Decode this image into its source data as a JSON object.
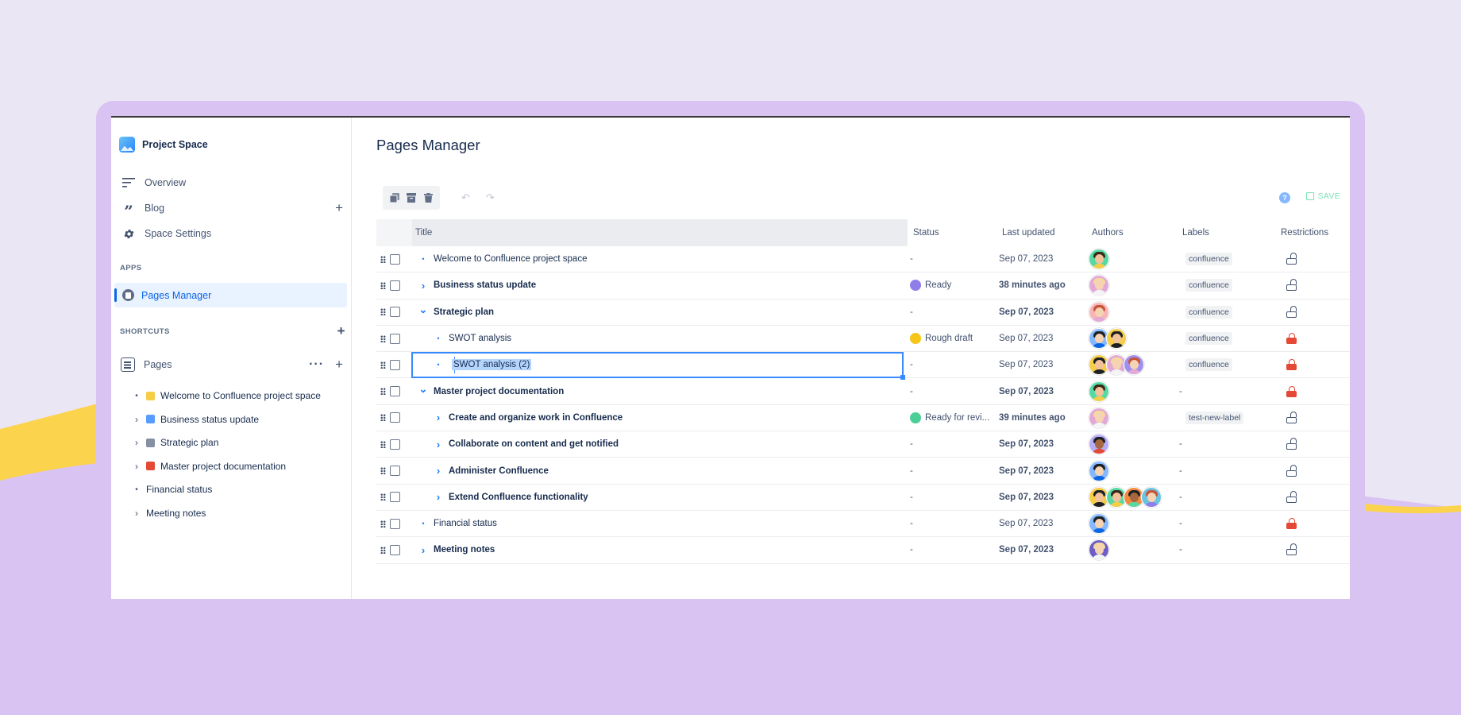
{
  "colors": {
    "background": "#ebe6f3",
    "frame": "#d8c3f3",
    "accent": "#0c66e4",
    "yellow_wave": "#fcd34d",
    "status_ready": "#8f7ee7",
    "status_rough_draft": "#f5c518",
    "status_ready_for_review": "#4bce97",
    "restriction_red": "#e34935"
  },
  "sidebar": {
    "space_name": "Project Space",
    "nav": [
      {
        "label": "Overview",
        "icon": "overview-icon"
      },
      {
        "label": "Blog",
        "icon": "quote-icon"
      },
      {
        "label": "Space Settings",
        "icon": "gear-icon"
      }
    ],
    "apps_label": "APPS",
    "active_app": "Pages Manager",
    "shortcuts_label": "SHORTCUTS",
    "pages_label": "Pages",
    "tree": [
      {
        "label": "Welcome to Confluence project space",
        "kind": "bullet",
        "emoji": "wave-emoji"
      },
      {
        "label": "Business status update",
        "kind": "chevron",
        "emoji": "monitor-emoji"
      },
      {
        "label": "Strategic plan",
        "kind": "chevron",
        "emoji": "chart-emoji"
      },
      {
        "label": "Master project documentation",
        "kind": "chevron",
        "emoji": "bookmark-emoji"
      },
      {
        "label": "Financial status",
        "kind": "bullet"
      },
      {
        "label": "Meeting notes",
        "kind": "chevron"
      }
    ]
  },
  "main": {
    "title": "Pages Manager",
    "save_label": "SAVE",
    "help_label": "?",
    "columns": {
      "title": "Title",
      "status": "Status",
      "updated": "Last updated",
      "authors": "Authors",
      "labels": "Labels",
      "restrictions": "Restrictions"
    },
    "rows": [
      {
        "title": "Welcome to Confluence project space",
        "indent": 0,
        "marker": "bullet",
        "bold": false,
        "status": "-",
        "updated": "Sep 07, 2023",
        "updated_bold": false,
        "authors": [
          "a-green"
        ],
        "label": "confluence",
        "lock": "open"
      },
      {
        "title": "Business status update",
        "indent": 0,
        "marker": "chevron-right",
        "bold": true,
        "status": "Ready",
        "status_color": "#8f7ee7",
        "updated": "38 minutes ago",
        "updated_bold": true,
        "authors": [
          "a-pink-blonde"
        ],
        "label": "confluence",
        "lock": "open"
      },
      {
        "title": "Strategic plan",
        "indent": 0,
        "marker": "chevron-down",
        "bold": true,
        "status": "-",
        "updated": "Sep 07, 2023",
        "updated_bold": true,
        "authors": [
          "a-pink-red"
        ],
        "label": "confluence",
        "lock": "open"
      },
      {
        "title": "SWOT analysis",
        "indent": 1,
        "marker": "bullet",
        "bold": false,
        "status": "Rough draft",
        "status_color": "#f5c518",
        "updated": "Sep 07, 2023",
        "updated_bold": false,
        "authors": [
          "a-blue-dark",
          "a-yellow-dark"
        ],
        "label": "confluence",
        "lock": "red"
      },
      {
        "title": "SWOT analysis (2)",
        "indent": 1,
        "marker": "bullet",
        "bold": false,
        "editing": true,
        "status": "-",
        "updated": "Sep 07, 2023",
        "updated_bold": false,
        "authors": [
          "a-yellow-dark",
          "a-pink-blonde",
          "a-purple-red"
        ],
        "label": "confluence",
        "lock": "red"
      },
      {
        "title": "Master project documentation",
        "indent": 0,
        "marker": "chevron-down",
        "bold": true,
        "status": "-",
        "updated": "Sep 07, 2023",
        "updated_bold": true,
        "authors": [
          "a-green"
        ],
        "label": "-",
        "lock": "red"
      },
      {
        "title": "Create and organize work in Confluence",
        "indent": 1,
        "marker": "chevron-right",
        "bold": true,
        "status": "Ready for revi...",
        "status_color": "#4bce97",
        "updated": "39 minutes ago",
        "updated_bold": true,
        "authors": [
          "a-pink-blonde"
        ],
        "label": "test-new-label",
        "lock": "open"
      },
      {
        "title": "Collaborate on content and get notified",
        "indent": 1,
        "marker": "chevron-right",
        "bold": true,
        "status": "-",
        "updated": "Sep 07, 2023",
        "updated_bold": true,
        "authors": [
          "a-purple-dark"
        ],
        "label": "-",
        "lock": "open"
      },
      {
        "title": "Administer Confluence",
        "indent": 1,
        "marker": "chevron-right",
        "bold": true,
        "status": "-",
        "updated": "Sep 07, 2023",
        "updated_bold": true,
        "authors": [
          "a-blue-dark"
        ],
        "label": "-",
        "lock": "open"
      },
      {
        "title": "Extend Confluence functionality",
        "indent": 1,
        "marker": "chevron-right",
        "bold": true,
        "status": "-",
        "updated": "Sep 07, 2023",
        "updated_bold": true,
        "authors": [
          "a-yellow-dark",
          "a-green",
          "a-orange-dark",
          "a-teal-red"
        ],
        "label": "-",
        "lock": "open"
      },
      {
        "title": "Financial status",
        "indent": 0,
        "marker": "bullet",
        "bold": false,
        "status": "-",
        "updated": "Sep 07, 2023",
        "updated_bold": false,
        "authors": [
          "a-blue-dark"
        ],
        "label": "-",
        "lock": "red"
      },
      {
        "title": "Meeting notes",
        "indent": 0,
        "marker": "chevron-right",
        "bold": true,
        "status": "-",
        "updated": "Sep 07, 2023",
        "updated_bold": true,
        "authors": [
          "a-purple-blonde"
        ],
        "label": "-",
        "lock": "open"
      }
    ]
  },
  "avatar_styles": {
    "a-green": {
      "bg": "#57d9a3",
      "hair": "#3a2a1a",
      "skin": "#f2c29b",
      "shirt": "#f5cd47"
    },
    "a-pink-blonde": {
      "bg": "#e2a9d6",
      "hair": "#f4d9a0",
      "skin": "#f6d3b3",
      "shirt": "#f4f5f7"
    },
    "a-pink-red": {
      "bg": "#f7b5b5",
      "hair": "#c6553a",
      "skin": "#f6d3b3",
      "shirt": "#e2a9d6"
    },
    "a-blue-dark": {
      "bg": "#85b8ff",
      "hair": "#1d2125",
      "skin": "#f6d3b3",
      "shirt": "#0c66e4"
    },
    "a-yellow-dark": {
      "bg": "#f5cd47",
      "hair": "#1d2125",
      "skin": "#f2c29b",
      "shirt": "#1d2125"
    },
    "a-purple-red": {
      "bg": "#9f8fef",
      "hair": "#c6553a",
      "skin": "#f6d3b3",
      "shirt": "#e2a9d6"
    },
    "a-purple-dark": {
      "bg": "#b8acf6",
      "hair": "#1d2125",
      "skin": "#a5673f",
      "shirt": "#e34935"
    },
    "a-orange-dark": {
      "bg": "#f38a3f",
      "hair": "#1d2125",
      "skin": "#a5673f",
      "shirt": "#57d9a3"
    },
    "a-teal-red": {
      "bg": "#6cc3e0",
      "hair": "#c6553a",
      "skin": "#f6d3b3",
      "shirt": "#8f7ee7"
    },
    "a-purple-blonde": {
      "bg": "#6e5dc6",
      "hair": "#f4d9a0",
      "skin": "#f6d3b3",
      "shirt": "#f4f5f7"
    }
  }
}
